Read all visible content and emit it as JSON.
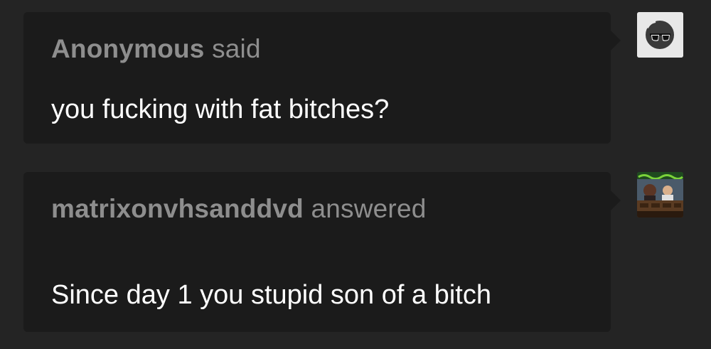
{
  "ask": {
    "asker": "Anonymous",
    "verb": "said",
    "question": "you fucking with fat bitches?",
    "avatar_icon": "anonymous-sunglasses-icon"
  },
  "answer": {
    "answerer": "matrixonvhsanddvd",
    "verb": "answered",
    "text": "Since day 1 you stupid son of a bitch",
    "avatar_icon": "user-avatar-thumbnail"
  },
  "colors": {
    "background": "#242424",
    "bubble": "#1b1b1b",
    "header_text": "#8e8e8e",
    "body_text": "#ffffff"
  }
}
